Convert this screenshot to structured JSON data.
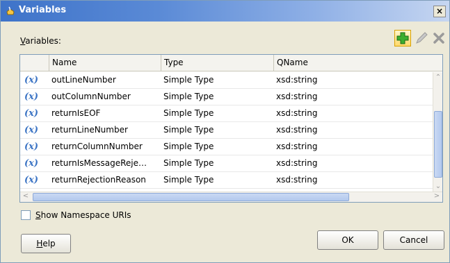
{
  "window": {
    "title": "Variables",
    "close_glyph": "×"
  },
  "toolbar": {
    "label_prefix": "V",
    "label_rest": "ariables:",
    "add_icon": "plus-icon",
    "edit_icon": "pencil-icon",
    "delete_icon": "x-icon"
  },
  "table": {
    "columns": [
      "Name",
      "Type",
      "QName"
    ],
    "rows": [
      {
        "icon": "(x)",
        "name": "outLineNumber",
        "type": "Simple Type",
        "qname": "xsd:string"
      },
      {
        "icon": "(x)",
        "name": "outColumnNumber",
        "type": "Simple Type",
        "qname": "xsd:string"
      },
      {
        "icon": "(x)",
        "name": "returnIsEOF",
        "type": "Simple Type",
        "qname": "xsd:string"
      },
      {
        "icon": "(x)",
        "name": "returnLineNumber",
        "type": "Simple Type",
        "qname": "xsd:string"
      },
      {
        "icon": "(x)",
        "name": "returnColumnNumber",
        "type": "Simple Type",
        "qname": "xsd:string"
      },
      {
        "icon": "(x)",
        "name": "returnIsMessageReje…",
        "type": "Simple Type",
        "qname": "xsd:string"
      },
      {
        "icon": "(x)",
        "name": "returnRejectionReason",
        "type": "Simple Type",
        "qname": "xsd:string"
      }
    ]
  },
  "options": {
    "show_ns_prefix": "S",
    "show_ns_rest": "how Namespace URIs",
    "show_ns_checked": false
  },
  "buttons": {
    "help_prefix": "H",
    "help_rest": "elp",
    "ok": "OK",
    "cancel": "Cancel"
  },
  "colors": {
    "title_gradient_start": "#3e73c9",
    "dialog_bg": "#ece9d8",
    "variable_icon": "#3a73c4",
    "add_button_highlight": "#ffd96b"
  }
}
